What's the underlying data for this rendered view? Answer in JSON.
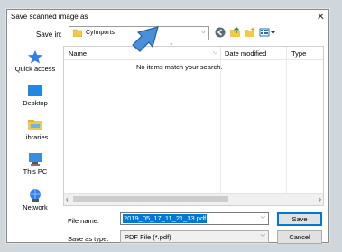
{
  "dialog": {
    "title": "Save scanned image as"
  },
  "toolbar": {
    "save_in_label": "Save in:",
    "folder": "CyImports",
    "icons": [
      "back-icon",
      "up-folder-icon",
      "new-folder-icon",
      "view-menu-icon"
    ]
  },
  "places": [
    {
      "label": "Quick access",
      "icon": "star-icon"
    },
    {
      "label": "Desktop",
      "icon": "desktop-icon"
    },
    {
      "label": "Libraries",
      "icon": "libraries-icon"
    },
    {
      "label": "This PC",
      "icon": "computer-icon"
    },
    {
      "label": "Network",
      "icon": "network-icon"
    }
  ],
  "list": {
    "columns": [
      "Name",
      "Date modified",
      "Type"
    ],
    "empty_message": "No items match your search."
  },
  "form": {
    "file_name_label": "File name:",
    "file_name_value": "2019_05_17_11_21_33.pdf",
    "save_as_type_label": "Save as type:",
    "save_as_type_value": "PDF File (*.pdf)"
  },
  "buttons": {
    "save": "Save",
    "cancel": "Cancel"
  },
  "colors": {
    "accent": "#0078d7",
    "callout_arrow": "#4a90d9"
  }
}
